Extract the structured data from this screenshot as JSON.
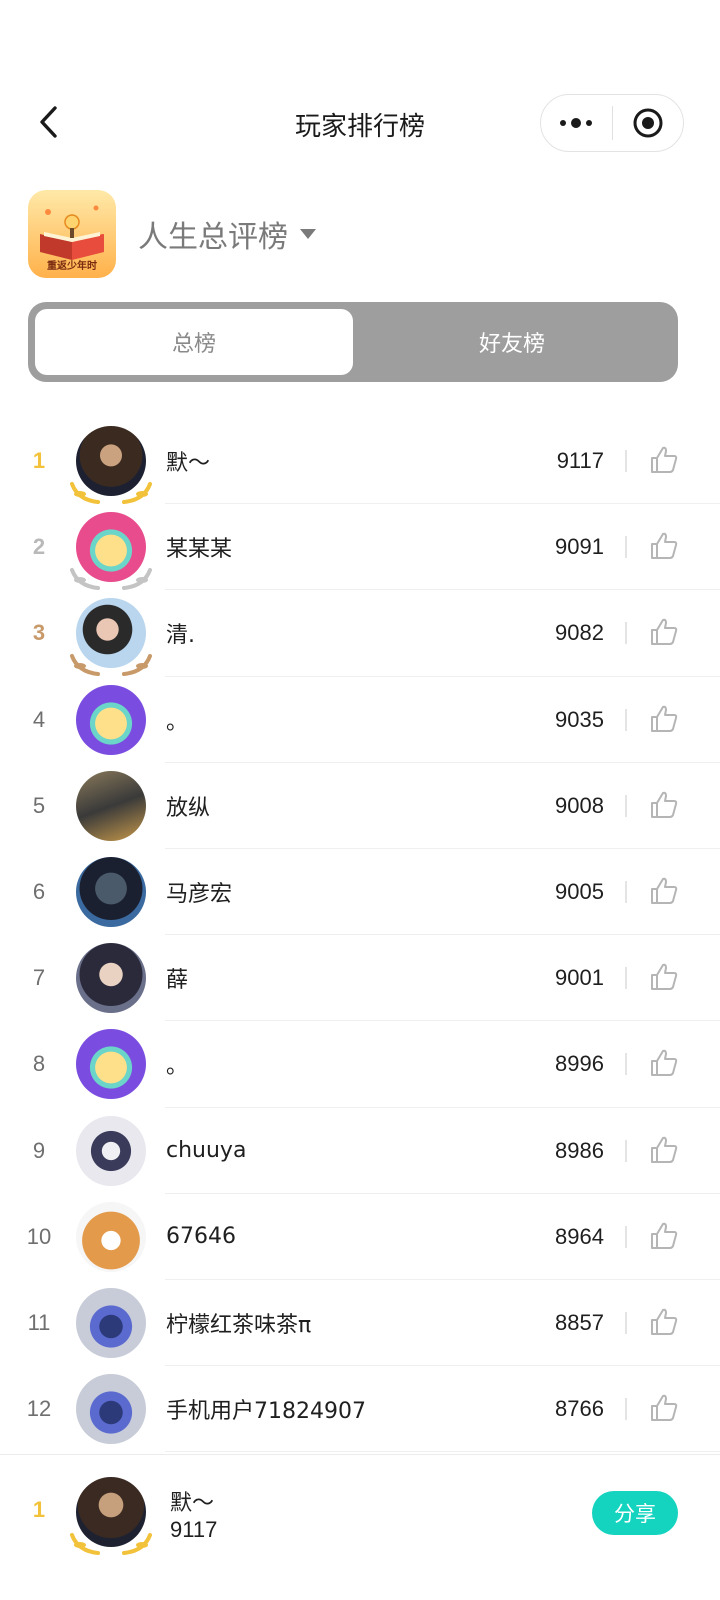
{
  "nav": {
    "title": "玩家排行榜"
  },
  "game": {
    "board_name": "人生总评榜",
    "icon_caption": "重返少年时"
  },
  "tabs": [
    {
      "label": "总榜",
      "active": true
    },
    {
      "label": "好友榜",
      "active": false
    }
  ],
  "colors": {
    "accent": "#14d3bf",
    "gold": "#f2c23a",
    "silver": "#b9b9b9",
    "bronze": "#c89a6a",
    "tab_track": "#9e9e9e"
  },
  "leaderboard": [
    {
      "rank": "1",
      "name": "默～",
      "score": "9117",
      "medal": "gold"
    },
    {
      "rank": "2",
      "name": "某某某",
      "score": "9091",
      "medal": "silver"
    },
    {
      "rank": "3",
      "name": "清.",
      "score": "9082",
      "medal": "bronze"
    },
    {
      "rank": "4",
      "name": "。",
      "score": "9035"
    },
    {
      "rank": "5",
      "name": "放纵",
      "score": "9008"
    },
    {
      "rank": "6",
      "name": "马彦宏",
      "score": "9005"
    },
    {
      "rank": "7",
      "name": "薛",
      "score": "9001"
    },
    {
      "rank": "8",
      "name": "。",
      "score": "8996"
    },
    {
      "rank": "9",
      "name": "chuuya",
      "score": "8986"
    },
    {
      "rank": "10",
      "name": "67646",
      "score": "8964"
    },
    {
      "rank": "11",
      "name": "柠檬红茶味茶π",
      "score": "8857"
    },
    {
      "rank": "12",
      "name": "手机用户71824907",
      "score": "8766"
    }
  ],
  "me": {
    "rank": "1",
    "name": "默～",
    "score": "9117",
    "share_label": "分享"
  }
}
